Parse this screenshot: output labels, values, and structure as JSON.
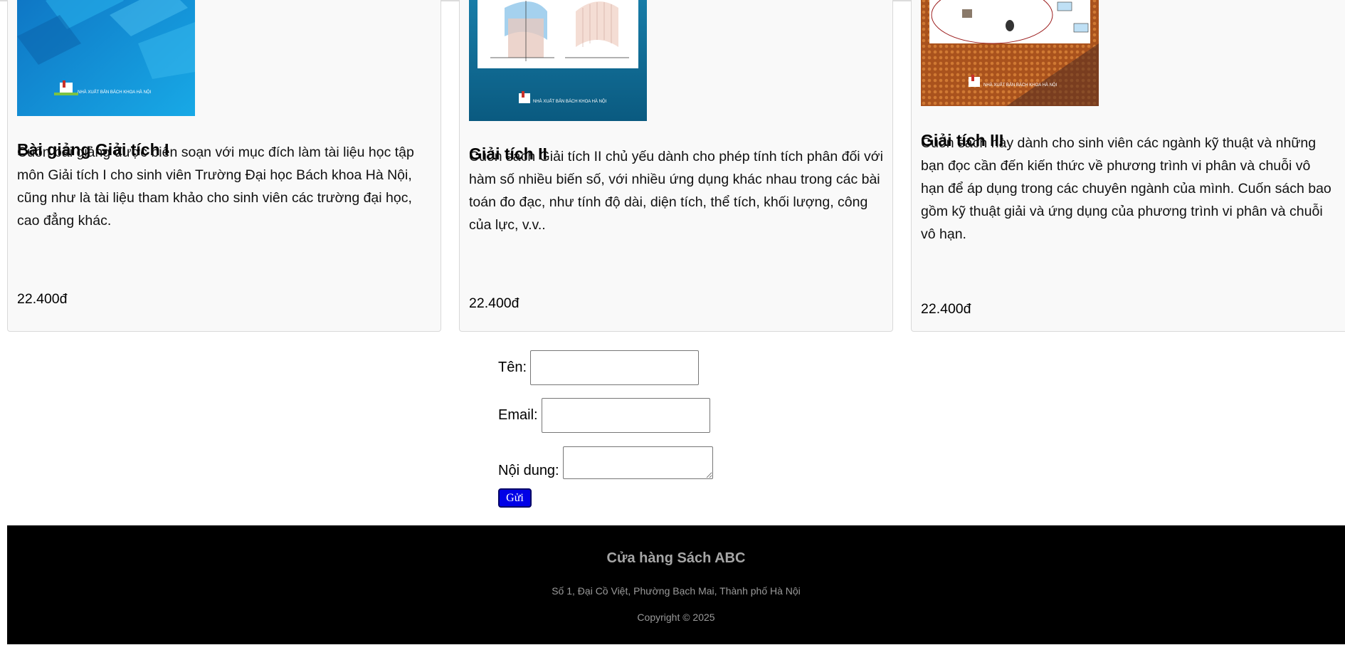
{
  "products": [
    {
      "title": "Bài giảng Giải tích I",
      "description": "Cuốn bài giảng được biên soạn với mục đích làm tài liệu học tập môn Giải tích I cho sinh viên Trường Đại học Bách khoa Hà Nội, cũng như là tài liệu tham khảo cho sinh viên các trường đại học, cao đẳng khác.",
      "price": "22.400đ",
      "publisher": "NHÀ XUẤT BẢN BÁCH KHOA HÀ NỘI",
      "cover_color": "#1a8fd4"
    },
    {
      "title": "Giải tích II",
      "description": "Cuốn sách Giải tích II chủ yếu dành cho phép tính tích phân đối với hàm số nhiều biến số, với nhiều ứng dụng khác nhau trong các bài toán đo đạc, như tính độ dài, diện tích, thể tích, khối lượng, công của lực, v.v..",
      "price": "22.400đ",
      "publisher": "NHÀ XUẤT BẢN BÁCH KHOA HÀ NỘI",
      "cover_color": "#0b6f97"
    },
    {
      "title": "Giải tích III",
      "description": "Cuốn sách này dành cho sinh viên các ngành kỹ thuật và những bạn đọc cần đến kiến thức về phương trình vi phân và chuỗi vô hạn để áp dụng trong các chuyên ngành của mình. Cuốn sách bao gồm kỹ thuật giải và ứng dụng của phương trình vi phân và chuỗi vô hạn.",
      "price": "22.400đ",
      "publisher": "NHÀ XUẤT BẢN BÁCH KHOA HÀ NỘI",
      "cover_color": "#c9672a"
    }
  ],
  "form": {
    "name_label": "Tên:",
    "name_value": "",
    "email_label": "Email:",
    "email_value": "",
    "message_label": "Nội dung:",
    "message_value": "",
    "submit_label": "Gửi",
    "submit_color": "#0000e6"
  },
  "footer": {
    "title": "Cửa hàng Sách ABC",
    "address": "Số 1, Đại Cồ Việt, Phường Bạch Mai, Thành phố Hà Nội",
    "copyright": "Copyright © 2025",
    "background": "#000000"
  }
}
